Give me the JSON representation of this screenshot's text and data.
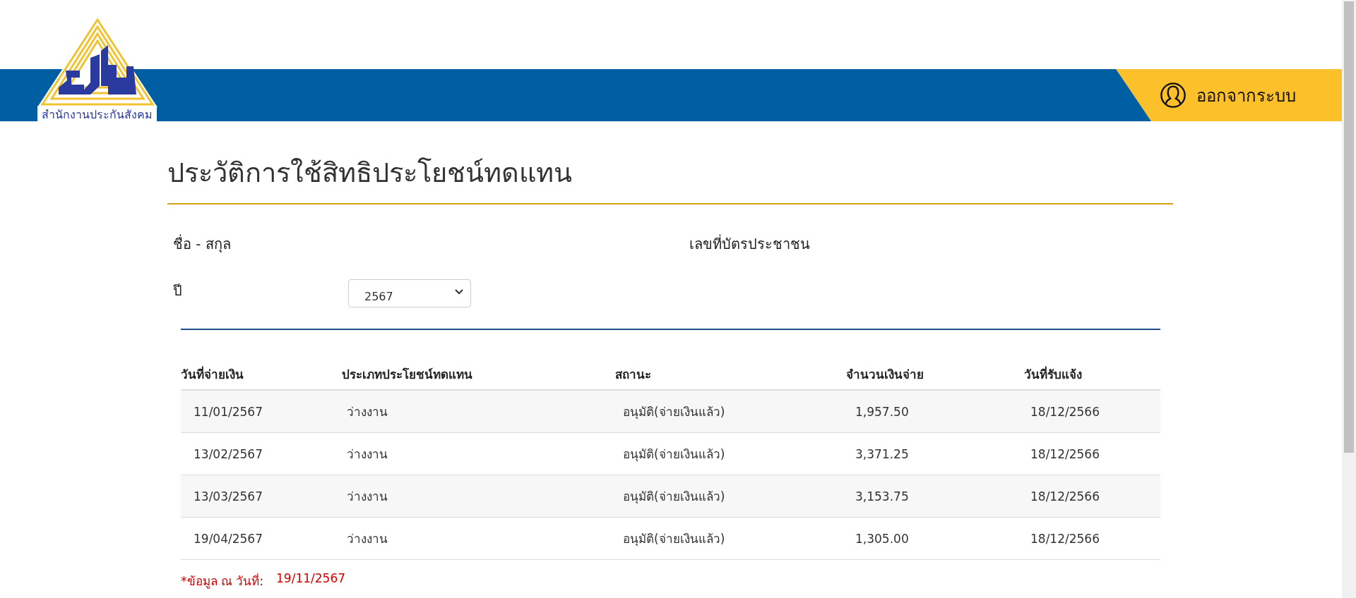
{
  "logo": {
    "caption": "สำนักงานประกันสังคม"
  },
  "header": {
    "logout_label": "ออกจากระบบ"
  },
  "page_title": "ประวัติการใช้สิทธิประโยชน์ทดแทน",
  "profile": {
    "name_label": "ชื่อ - สกุล",
    "id_label": "เลขที่บัตรประชาชน",
    "year_label": "ปี",
    "year_value": "2567"
  },
  "table": {
    "columns": [
      "วันที่จ่ายเงิน",
      "ประเภทประโยชน์ทดแทน",
      "สถานะ",
      "จำนวนเงินจ่าย",
      "วันที่รับแจ้ง"
    ],
    "rows": [
      [
        "11/01/2567",
        "ว่างงาน",
        "อนุมัติ(จ่ายเงินแล้ว)",
        "1,957.50",
        "18/12/2566"
      ],
      [
        "13/02/2567",
        "ว่างงาน",
        "อนุมัติ(จ่ายเงินแล้ว)",
        "3,371.25",
        "18/12/2566"
      ],
      [
        "13/03/2567",
        "ว่างงาน",
        "อนุมัติ(จ่ายเงินแล้ว)",
        "3,153.75",
        "18/12/2566"
      ],
      [
        "19/04/2567",
        "ว่างงาน",
        "อนุมัติ(จ่ายเงินแล้ว)",
        "1,305.00",
        "18/12/2566"
      ]
    ]
  },
  "footnote": {
    "label": "*ข้อมูล ณ วันที่:",
    "date": "19/11/2567"
  }
}
